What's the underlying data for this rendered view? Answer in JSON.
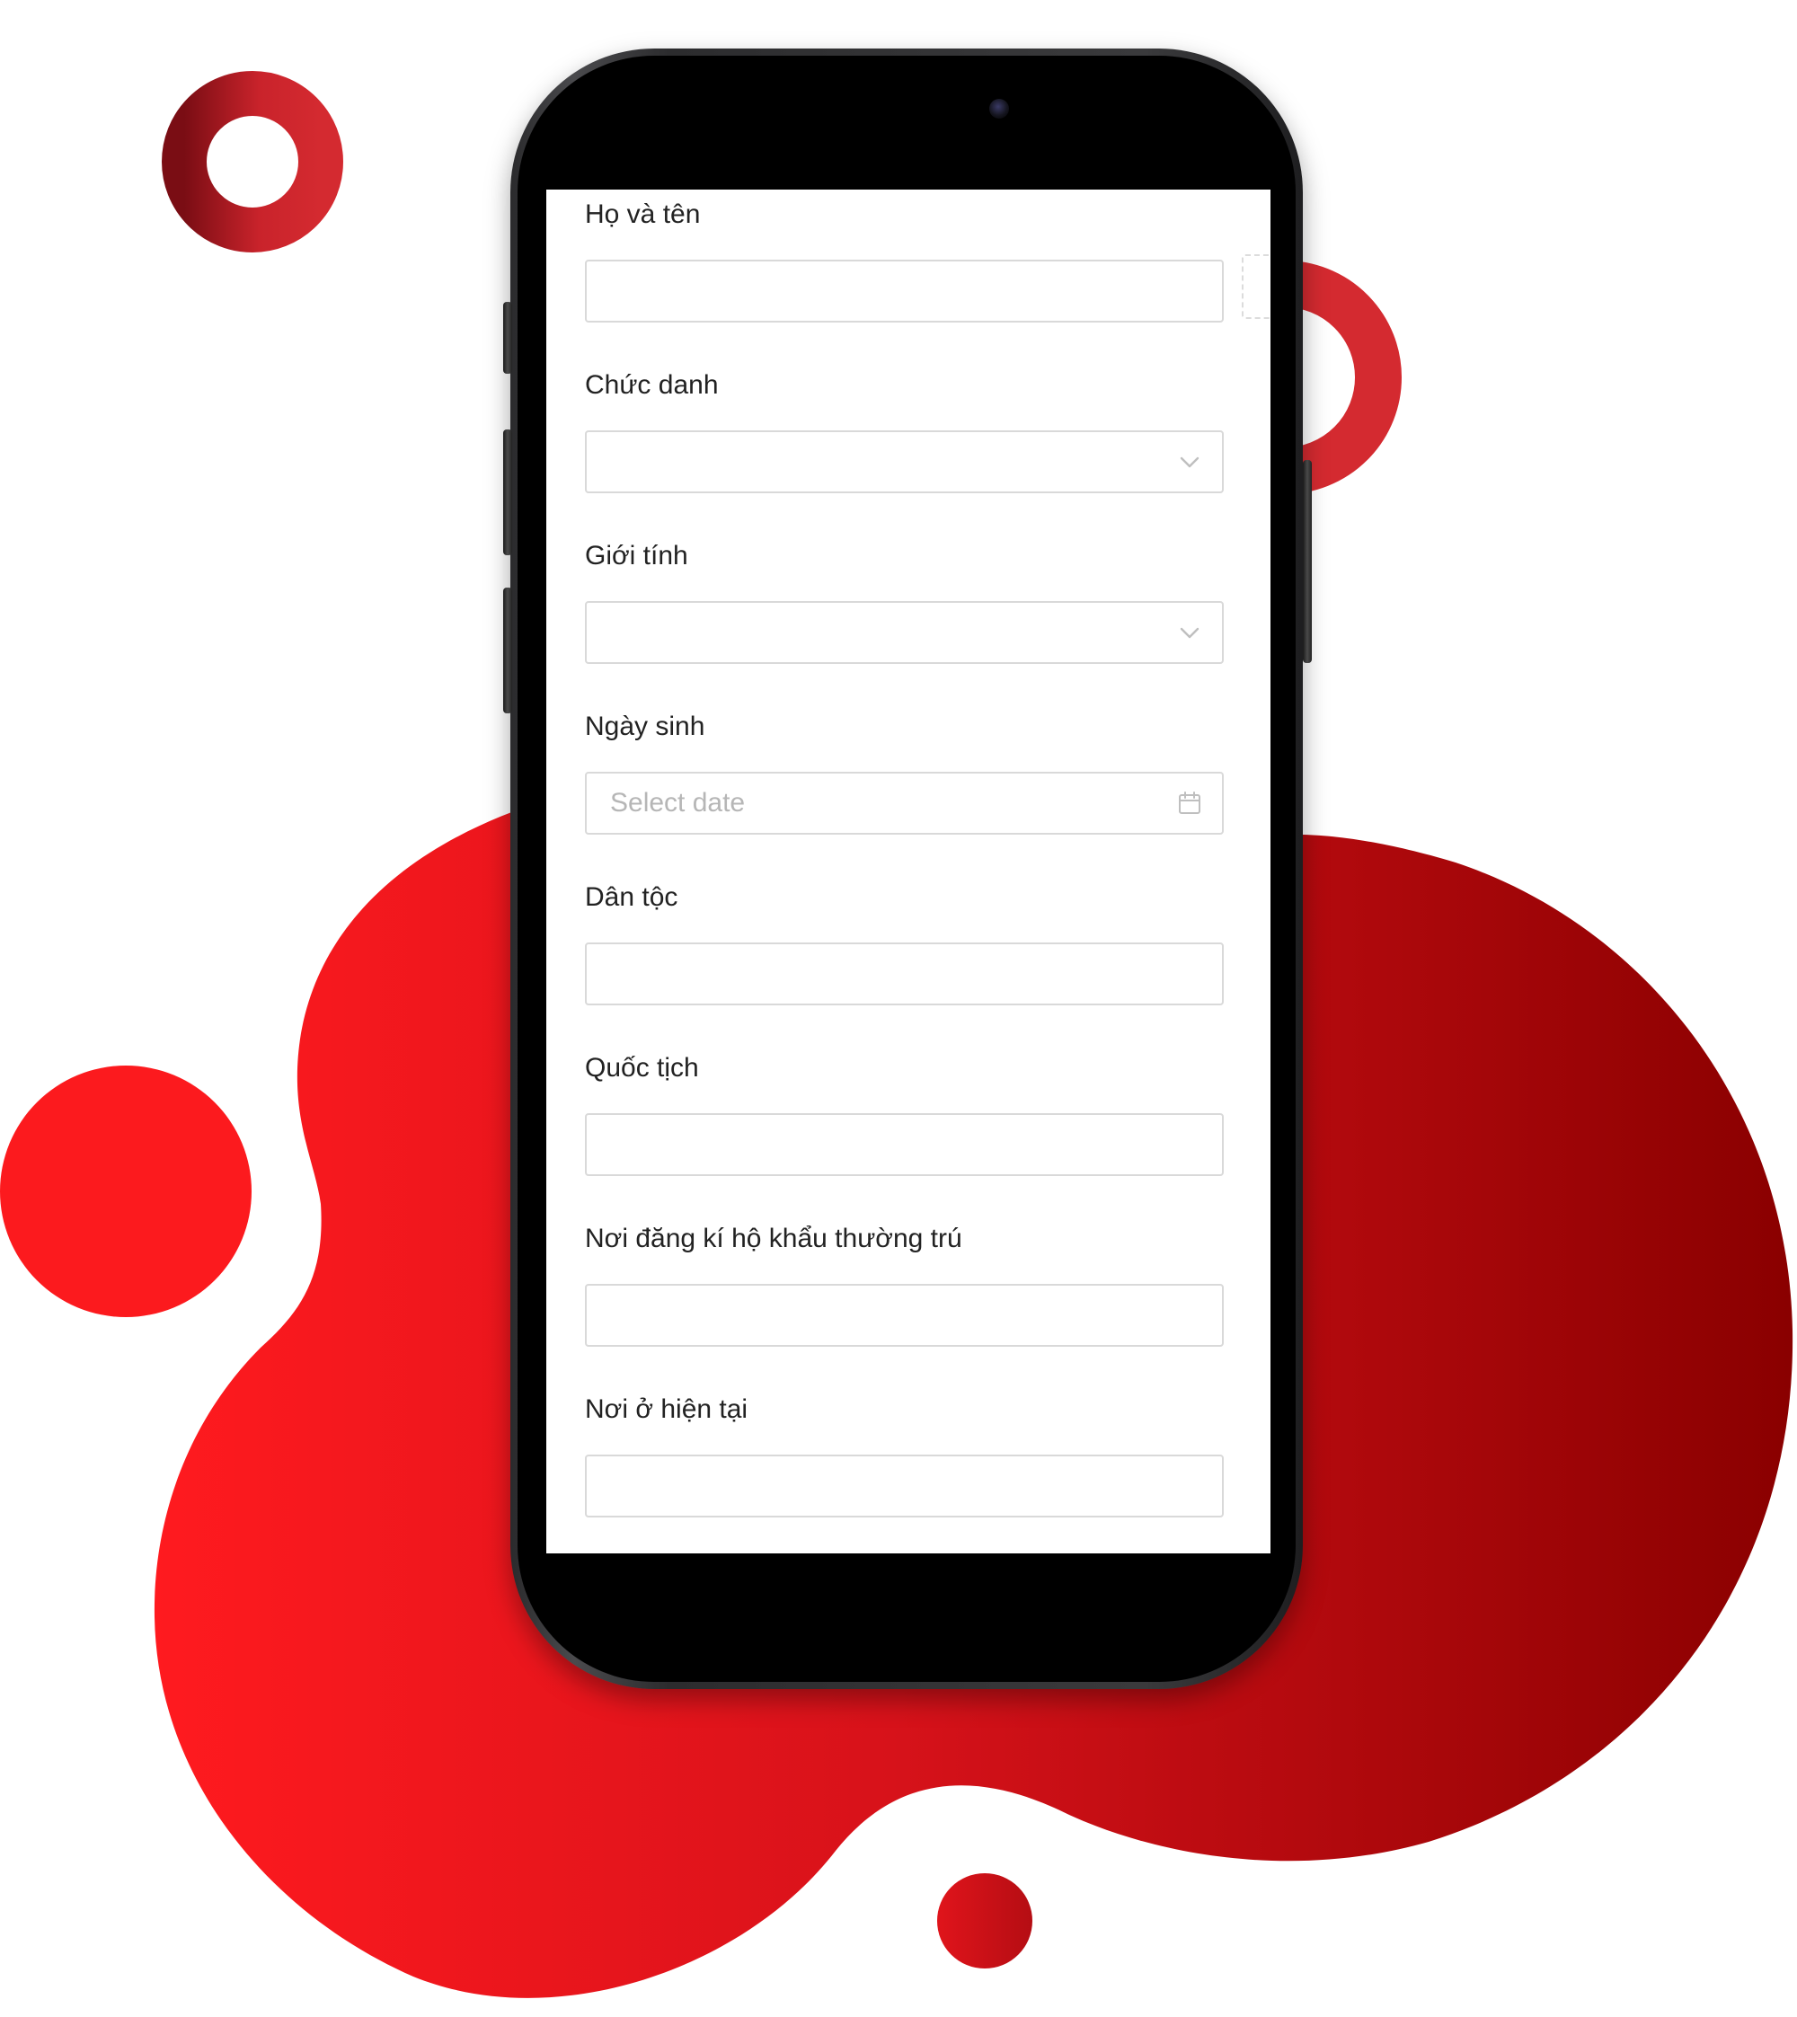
{
  "colors": {
    "accent": "#e8141b",
    "accent_dark": "#8c0000",
    "ring_dark": "#7a0d14",
    "ring_light": "#d42a30",
    "input_border": "#d9d9d9",
    "placeholder": "#b6b6b6",
    "label": "#222222"
  },
  "form": {
    "fields": [
      {
        "label": "Họ và tên",
        "type": "text",
        "value": ""
      },
      {
        "label": "Chức danh",
        "type": "select",
        "value": "",
        "icon": "chevron-down-icon"
      },
      {
        "label": "Giới tính",
        "type": "select",
        "value": "",
        "icon": "chevron-down-icon"
      },
      {
        "label": "Ngày sinh",
        "type": "date",
        "placeholder": "Select date",
        "icon": "calendar-icon"
      },
      {
        "label": "Dân tộc",
        "type": "text",
        "value": ""
      },
      {
        "label": "Quốc tịch",
        "type": "text",
        "value": ""
      },
      {
        "label": "Nơi đăng kí hộ khẩu thường trú",
        "type": "text",
        "value": ""
      },
      {
        "label": "Nơi ở hiện tại",
        "type": "text",
        "value": ""
      }
    ]
  }
}
